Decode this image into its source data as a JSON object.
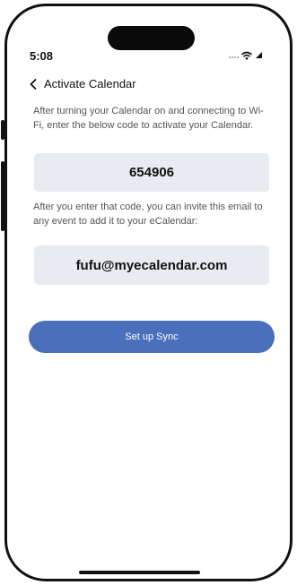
{
  "status_bar": {
    "time": "5:08",
    "icons": [
      "signal-dots-icon",
      "wifi-icon",
      "battery-icon"
    ]
  },
  "header": {
    "back_icon": "chevron-left-icon",
    "title": "Activate Calendar"
  },
  "instructions": {
    "activation": "After turning your Calendar on and connecting to Wi-Fi, enter the below code to activate your Calendar.",
    "invite": "After you enter that code, you can invite this email to any event to add it to your eCalendar:"
  },
  "activation_code": "654906",
  "calendar_email": "fufu@myecalendar.com",
  "actions": {
    "setup_sync_label": "Set up Sync"
  },
  "colors": {
    "accent": "#4a6fbb",
    "field_background": "#e8ebef",
    "frame": "#111111"
  }
}
